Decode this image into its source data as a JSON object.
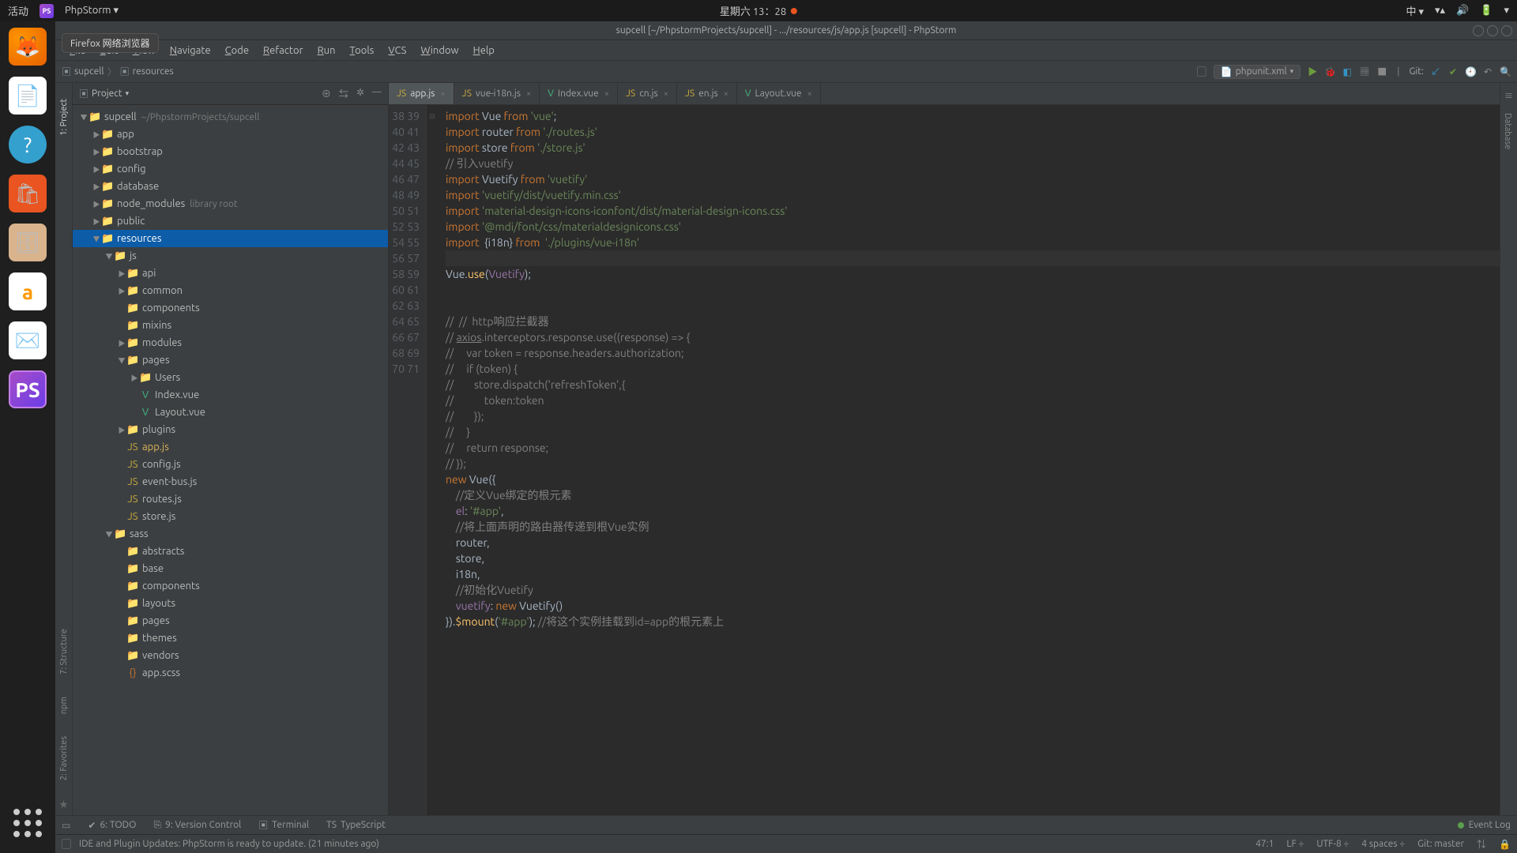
{
  "gnome": {
    "activities": "活动",
    "app": "PhpStorm ▾",
    "clock": "星期六 13：28",
    "ime": "中 ▾",
    "tooltip": "Firefox 网络浏览器"
  },
  "window": {
    "title": "supcell [~/PhpstormProjects/supcell] - .../resources/js/app.js [supcell] - PhpStorm"
  },
  "menu": [
    "File",
    "Edit",
    "View",
    "Navigate",
    "Code",
    "Refactor",
    "Run",
    "Tools",
    "VCS",
    "Window",
    "Help"
  ],
  "breadcrumb": {
    "a": "supcell",
    "b": "resources"
  },
  "toolbar": {
    "config_icon": "📄",
    "config": "phpunit.xml",
    "git_label": "Git:"
  },
  "left_labels": {
    "project": "1: Project",
    "structure": "7: Structure",
    "npm": "npm",
    "favorites": "2: Favorites"
  },
  "right_labels": {
    "database": "Database"
  },
  "pane": {
    "title": "Project"
  },
  "tree": [
    {
      "d": 0,
      "exp": "▼",
      "ico": "📁",
      "cls": "folder-ico",
      "txt": "supcell",
      "suf": "~/PhpstormProjects/supcell"
    },
    {
      "d": 1,
      "exp": "▶",
      "ico": "📁",
      "cls": "folder-ico",
      "txt": "app"
    },
    {
      "d": 1,
      "exp": "▶",
      "ico": "📁",
      "cls": "folder-ico",
      "txt": "bootstrap"
    },
    {
      "d": 1,
      "exp": "▶",
      "ico": "📁",
      "cls": "folder-ico",
      "txt": "config"
    },
    {
      "d": 1,
      "exp": "▶",
      "ico": "📁",
      "cls": "folder-ico",
      "txt": "database"
    },
    {
      "d": 1,
      "exp": "▶",
      "ico": "📁",
      "cls": "folder-ico",
      "txt": "node_modules",
      "suf": "library root"
    },
    {
      "d": 1,
      "exp": "▶",
      "ico": "📁",
      "cls": "folder-ico",
      "txt": "public"
    },
    {
      "d": 1,
      "exp": "▼",
      "ico": "📁",
      "cls": "folder-ico",
      "txt": "resources",
      "sel": true
    },
    {
      "d": 2,
      "exp": "▼",
      "ico": "📁",
      "cls": "folder-ico",
      "txt": "js"
    },
    {
      "d": 3,
      "exp": "▶",
      "ico": "📁",
      "cls": "folder-ico",
      "txt": "api"
    },
    {
      "d": 3,
      "exp": "▶",
      "ico": "📁",
      "cls": "folder-ico",
      "txt": "common"
    },
    {
      "d": 3,
      "exp": "",
      "ico": "📁",
      "cls": "folder-ico",
      "txt": "components"
    },
    {
      "d": 3,
      "exp": "",
      "ico": "📁",
      "cls": "folder-ico",
      "txt": "mixins"
    },
    {
      "d": 3,
      "exp": "▶",
      "ico": "📁",
      "cls": "folder-ico",
      "txt": "modules"
    },
    {
      "d": 3,
      "exp": "▼",
      "ico": "📁",
      "cls": "folder-ico",
      "txt": "pages"
    },
    {
      "d": 4,
      "exp": "▶",
      "ico": "📁",
      "cls": "folder-ico",
      "txt": "Users"
    },
    {
      "d": 4,
      "exp": "",
      "ico": "V",
      "cls": "vue-ico",
      "txt": "Index.vue"
    },
    {
      "d": 4,
      "exp": "",
      "ico": "V",
      "cls": "vue-ico",
      "txt": "Layout.vue"
    },
    {
      "d": 3,
      "exp": "▶",
      "ico": "📁",
      "cls": "folder-ico",
      "txt": "plugins"
    },
    {
      "d": 3,
      "exp": "",
      "ico": "JS",
      "cls": "js-ico",
      "txt": "app.js",
      "hl": true
    },
    {
      "d": 3,
      "exp": "",
      "ico": "JS",
      "cls": "js-ico",
      "txt": "config.js"
    },
    {
      "d": 3,
      "exp": "",
      "ico": "JS",
      "cls": "js-ico",
      "txt": "event-bus.js"
    },
    {
      "d": 3,
      "exp": "",
      "ico": "JS",
      "cls": "js-ico",
      "txt": "routes.js"
    },
    {
      "d": 3,
      "exp": "",
      "ico": "JS",
      "cls": "js-ico",
      "txt": "store.js"
    },
    {
      "d": 2,
      "exp": "▼",
      "ico": "📁",
      "cls": "folder-ico",
      "txt": "sass"
    },
    {
      "d": 3,
      "exp": "",
      "ico": "📁",
      "cls": "folder-ico",
      "txt": "abstracts"
    },
    {
      "d": 3,
      "exp": "",
      "ico": "📁",
      "cls": "folder-ico",
      "txt": "base"
    },
    {
      "d": 3,
      "exp": "",
      "ico": "📁",
      "cls": "folder-ico",
      "txt": "components"
    },
    {
      "d": 3,
      "exp": "",
      "ico": "📁",
      "cls": "folder-ico",
      "txt": "layouts"
    },
    {
      "d": 3,
      "exp": "",
      "ico": "📁",
      "cls": "folder-ico",
      "txt": "pages"
    },
    {
      "d": 3,
      "exp": "",
      "ico": "📁",
      "cls": "folder-ico",
      "txt": "themes"
    },
    {
      "d": 3,
      "exp": "",
      "ico": "📁",
      "cls": "folder-ico",
      "txt": "vendors"
    },
    {
      "d": 3,
      "exp": "",
      "ico": "{}",
      "cls": "orange",
      "txt": "app.scss"
    }
  ],
  "tabs": [
    {
      "ico": "JS",
      "cls": "js-ico",
      "label": "app.js",
      "active": true
    },
    {
      "ico": "JS",
      "cls": "js-ico",
      "label": "vue-i18n.js"
    },
    {
      "ico": "V",
      "cls": "vue-ico",
      "label": "Index.vue"
    },
    {
      "ico": "JS",
      "cls": "js-ico",
      "label": "cn.js"
    },
    {
      "ico": "JS",
      "cls": "js-ico",
      "label": "en.js"
    },
    {
      "ico": "V",
      "cls": "vue-ico",
      "label": "Layout.vue"
    }
  ],
  "code": {
    "start": 38,
    "lines": [
      "<span class='kw'>import</span> Vue <span class='kw'>from</span> <span class='str'>'vue'</span>;",
      "<span class='kw'>import</span> router <span class='kw'>from</span> <span class='str'>'./routes.js'</span>",
      "<span class='kw'>import</span> store <span class='kw'>from</span> <span class='str'>'./store.js'</span>",
      "<span class='cmt'>// 引入vuetify</span>",
      "<span class='kw'>import</span> Vuetify <span class='kw'>from</span> <span class='str'>'vuetify'</span>",
      "<span class='kw'>import</span> <span class='str'>'vuetify/dist/vuetify.min.css'</span>",
      "<span class='kw'>import</span> <span class='str'>'material-design-icons-iconfont/dist/material-design-icons.css'</span>",
      "<span class='kw'>import</span> <span class='str'>'@mdi/font/css/materialdesignicons.css'</span>",
      "<span class='kw'>import</span>  {i18n} <span class='kw'>from</span>  <span class='str'>'./plugins/vue-i18n'</span>",
      "",
      "Vue.<span class='fn'>use</span>(<span class='id'>Vuetify</span>);",
      "",
      "",
      "<span class='cmt'>//  //  http响应拦截器</span>",
      "<span class='cmt'>// <u>axios</u>.interceptors.response.use((response) =&gt; {</span>",
      "<span class='cmt'>//     var token = response.headers.authorization;</span>",
      "<span class='cmt'>//     if (token) {</span>",
      "<span class='cmt'>//        store.dispatch('refreshToken',{</span>",
      "<span class='cmt'>//            token:token</span>",
      "<span class='cmt'>//        });</span>",
      "<span class='cmt'>//     }</span>",
      "<span class='cmt'>//     return response;</span>",
      "<span class='cmt'>// });</span>",
      "<span class='kw'>new</span> Vue({",
      "    <span class='cmt'>//定义Vue绑定的根元素</span>",
      "    <span class='id'>el</span>: <span class='str'>'#app'</span>,",
      "    <span class='cmt'>//将上面声明的路由器传递到根Vue实例</span>",
      "    router,",
      "    store,",
      "    i18n,",
      "    <span class='cmt'>//初始化Vuetify</span>",
      "    <span class='id'>vuetify</span>: <span class='kw'>new</span> Vuetify()",
      "}).<span class='fn'>$mount</span>(<span class='str'>'#app'</span>); <span class='cmt'>//将这个实例挂载到id=app的根元素上</span>",
      ""
    ]
  },
  "bottom": {
    "todo": "6: TODO",
    "vcs": "9: Version Control",
    "terminal": "Terminal",
    "typescript": "TypeScript",
    "eventlog": "Event Log"
  },
  "status": {
    "msg": "IDE and Plugin Updates: PhpStorm is ready to update. (21 minutes ago)",
    "pos": "47:1",
    "le": "LF",
    "enc": "UTF-8",
    "indent": "4 spaces",
    "branch": "Git: master"
  }
}
